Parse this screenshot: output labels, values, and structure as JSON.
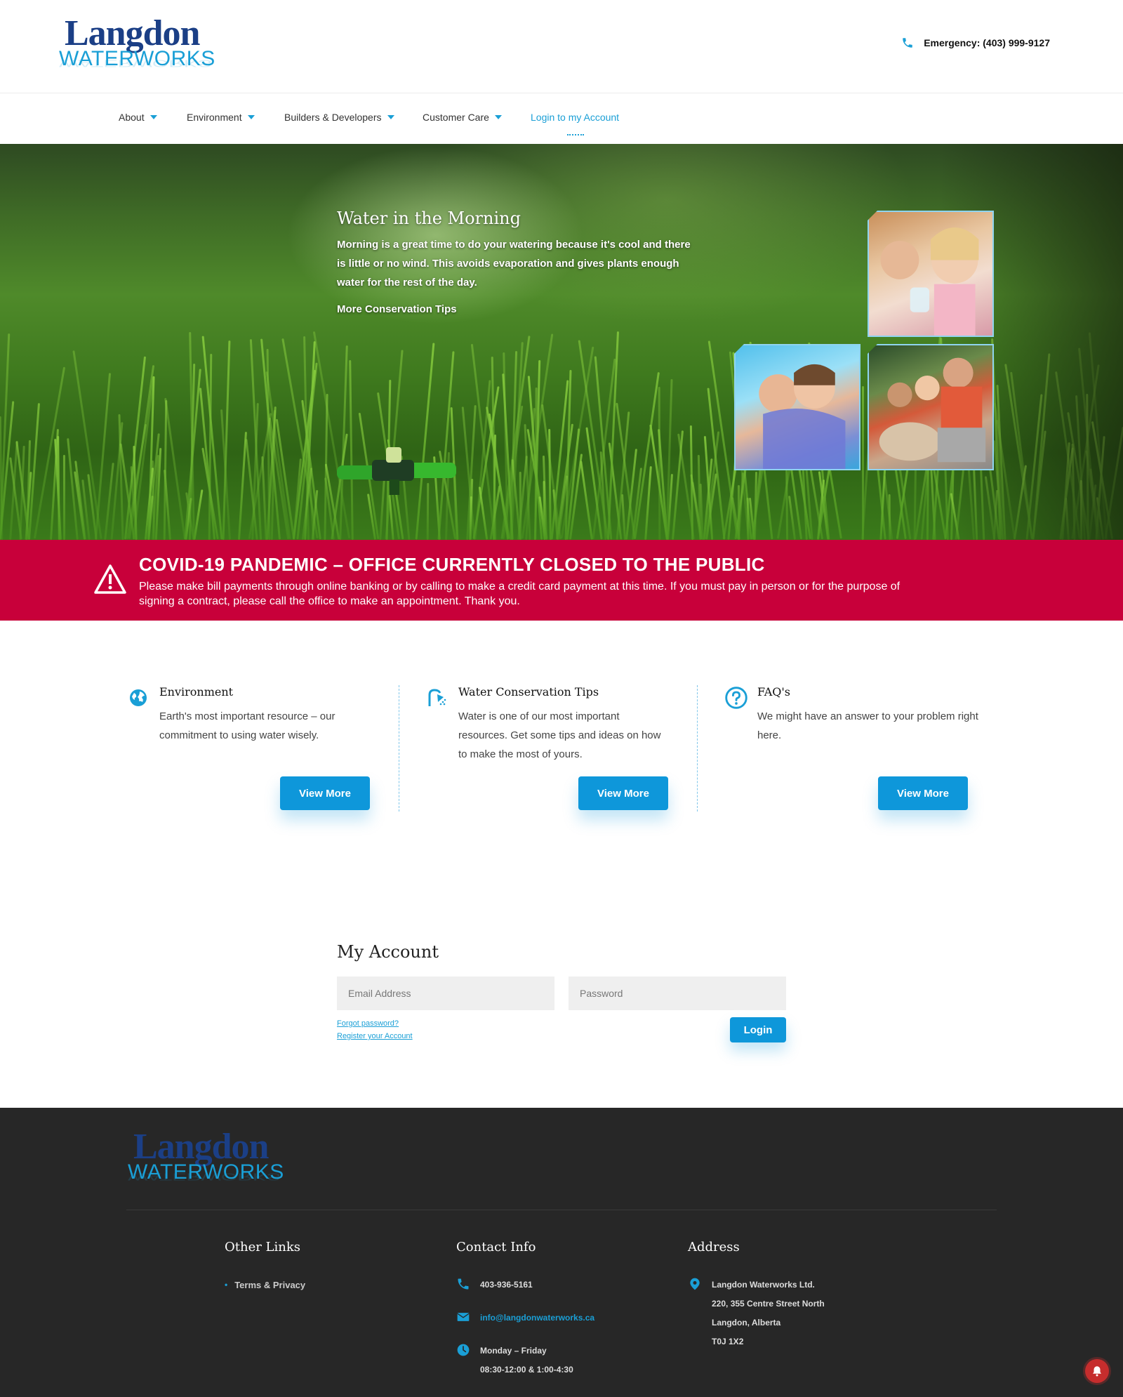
{
  "brand": {
    "name_top": "Langdon",
    "name_bottom": "WATERWORKS",
    "accent_color": "#1a9fd6",
    "brand_blue": "#1b3f86"
  },
  "header": {
    "emergency_label": "Emergency: (403) 999-9127",
    "emergency_icon": "phone-icon"
  },
  "nav": {
    "items": [
      {
        "label": "About",
        "has_dropdown": true
      },
      {
        "label": "Environment",
        "has_dropdown": true
      },
      {
        "label": "Builders & Developers",
        "has_dropdown": true
      },
      {
        "label": "Customer Care",
        "has_dropdown": true
      },
      {
        "label": "Login to my Account",
        "has_dropdown": false,
        "active": true
      }
    ]
  },
  "hero": {
    "title": "Water in the Morning",
    "body": "Morning is a great time to do your watering because it's cool and there is little or no wind. This avoids evaporation and gives plants enough water for the rest of the day.",
    "link": "More Conservation Tips"
  },
  "alert": {
    "color": "#c8003a",
    "icon": "warning-icon",
    "title": "COVID-19 PANDEMIC – OFFICE CURRENTLY CLOSED TO THE PUBLIC",
    "body": "Please make bill payments through online banking or by calling to make a credit card payment at this time. If you must pay in person or for the purpose of signing a contract, please call the office to make an appointment. Thank you."
  },
  "features": [
    {
      "icon": "globe-icon",
      "title": "Environment",
      "body": "Earth's most important resource – our commitment to using water wisely.",
      "button": "View More"
    },
    {
      "icon": "shower-icon",
      "title": "Water Conservation Tips",
      "body": "Water is one of our most important resources. Get some tips and ideas on how to make the most of yours.",
      "button": "View More"
    },
    {
      "icon": "question-icon",
      "title": "FAQ's",
      "body": "We might have an answer to your problem right here.",
      "button": "View More"
    }
  ],
  "account": {
    "title": "My Account",
    "email_placeholder": "Email Address",
    "password_placeholder": "Password",
    "forgot_link": "Forgot password?",
    "register_link": "Register your Account",
    "login_button": "Login"
  },
  "footer": {
    "other_links": {
      "title": "Other Links",
      "items": [
        "Terms & Privacy"
      ]
    },
    "contact": {
      "title": "Contact Info",
      "phone": "403-936-5161",
      "email": "info@langdonwaterworks.ca",
      "hours_days": "Monday – Friday",
      "hours_times": "08:30-12:00 & 1:00-4:30"
    },
    "address": {
      "title": "Address",
      "line1": "Langdon Waterworks Ltd.",
      "line2": "220, 355 Centre Street North",
      "line3": "Langdon, Alberta",
      "line4": "T0J 1X2"
    }
  }
}
